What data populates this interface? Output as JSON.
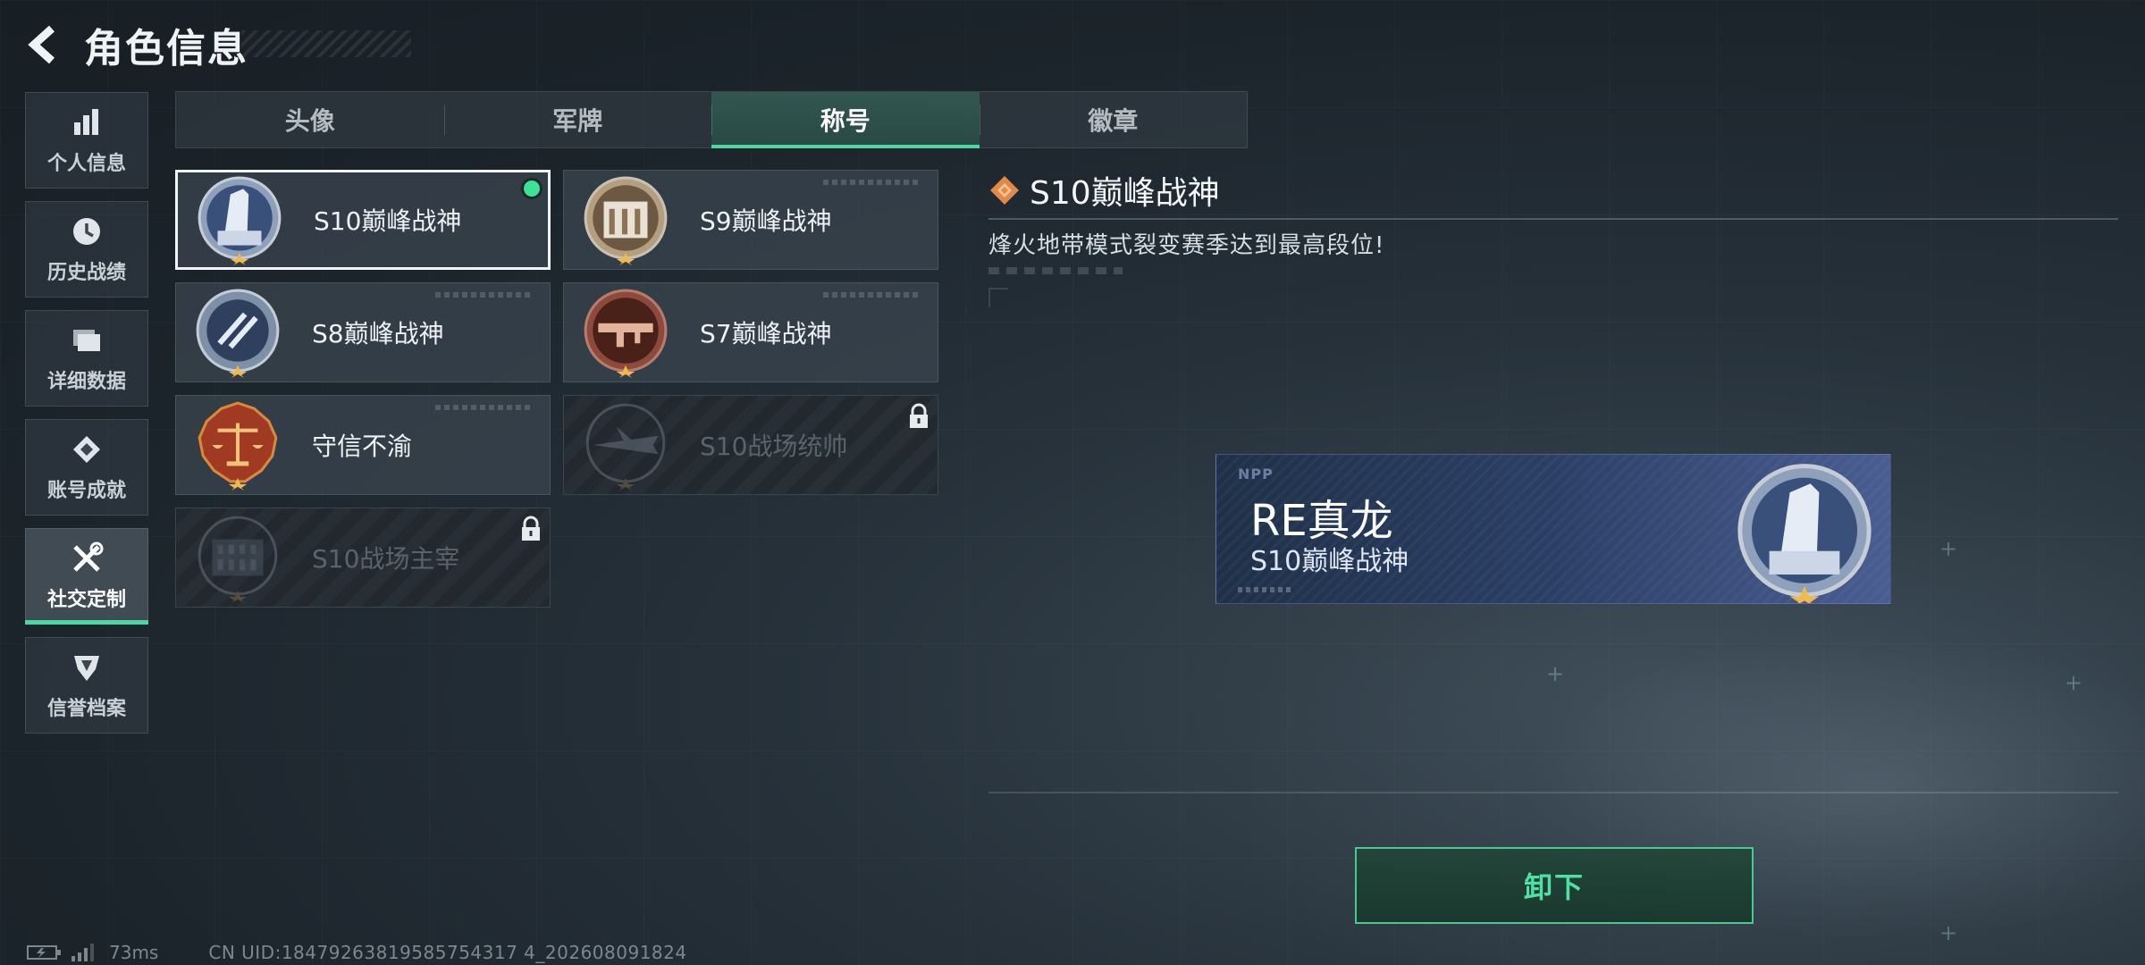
{
  "header": {
    "title": "角色信息"
  },
  "sidebar": {
    "items": [
      {
        "label": "个人信息",
        "icon": "bar-chart-icon"
      },
      {
        "label": "历史战绩",
        "icon": "clock-icon"
      },
      {
        "label": "详细数据",
        "icon": "folder-icon"
      },
      {
        "label": "账号成就",
        "icon": "achievement-icon"
      },
      {
        "label": "社交定制",
        "icon": "tools-icon",
        "active": true
      },
      {
        "label": "信誉档案",
        "icon": "shield-icon"
      }
    ]
  },
  "tabs": [
    {
      "label": "头像"
    },
    {
      "label": "军牌"
    },
    {
      "label": "称号",
      "active": true
    },
    {
      "label": "徽章"
    }
  ],
  "titles": [
    {
      "name": "S10巅峰战神",
      "badge": "tower-badge-icon",
      "selected": true,
      "equipped": true,
      "locked": false
    },
    {
      "name": "S9巅峰战神",
      "badge": "dam-badge-icon",
      "selected": false,
      "equipped": false,
      "locked": false
    },
    {
      "name": "S8巅峰战神",
      "badge": "stripes-badge-icon",
      "selected": false,
      "equipped": false,
      "locked": false
    },
    {
      "name": "S7巅峰战神",
      "badge": "rifle-badge-icon",
      "selected": false,
      "equipped": false,
      "locked": false
    },
    {
      "name": "守信不渝",
      "badge": "scales-badge-icon",
      "selected": false,
      "equipped": false,
      "locked": false
    },
    {
      "name": "S10战场统帅",
      "badge": "aircraft-badge-icon",
      "selected": false,
      "equipped": false,
      "locked": true
    },
    {
      "name": "S10战场主宰",
      "badge": "colosseum-badge-icon",
      "selected": false,
      "equipped": false,
      "locked": true
    }
  ],
  "detail": {
    "title": "S10巅峰战神",
    "description": "烽火地带模式裂变赛季达到最高段位!"
  },
  "preview": {
    "logo": "NPP",
    "player_name": "RE真龙",
    "title": "S10巅峰战神"
  },
  "actions": {
    "unequip_label": "卸下"
  },
  "status": {
    "latency": "73ms",
    "uid": "CN UID:18479263819585754317 4_202608091824"
  },
  "colors": {
    "accent": "#4fd6a0",
    "equipped": "#3fe09a",
    "icon_orange": "#e08a4a"
  }
}
